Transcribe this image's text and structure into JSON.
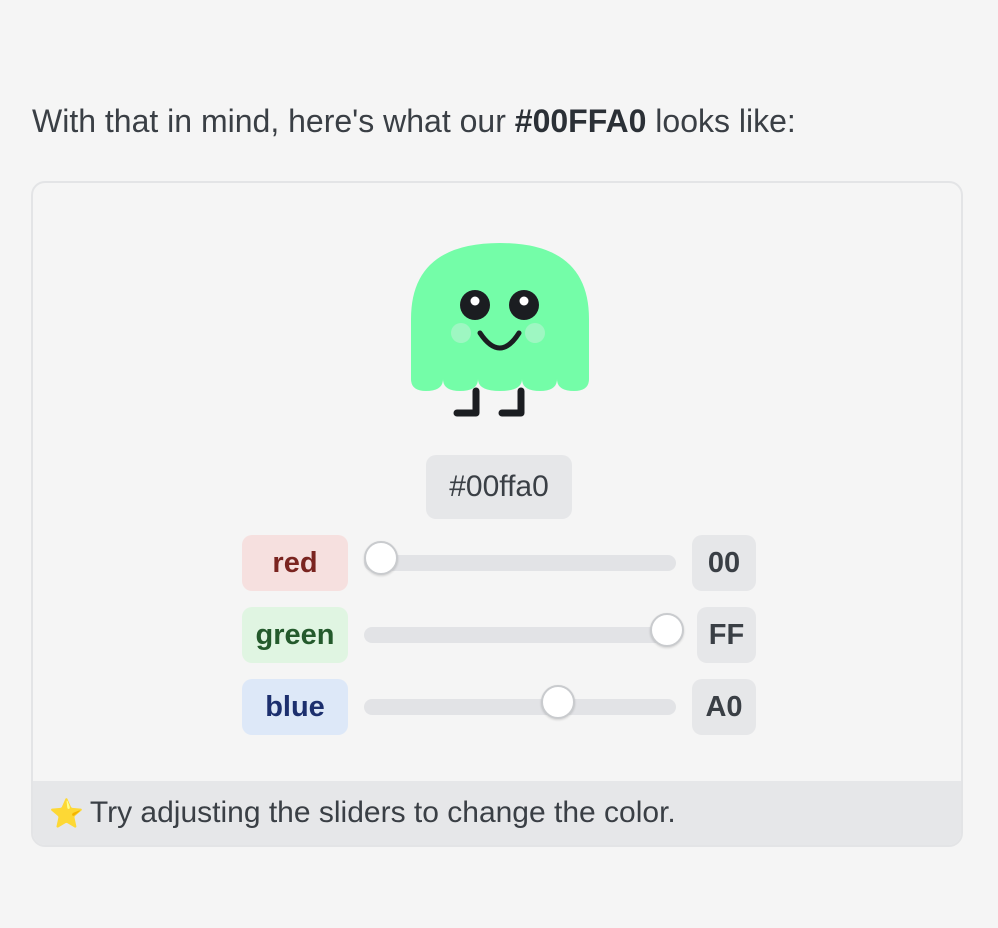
{
  "intro": {
    "prefix": "With that in mind, here's what our ",
    "code": "#00FFA0",
    "suffix": " looks like:"
  },
  "card": {
    "monster_color": "#74fda8",
    "hex_value": "#00ffa0",
    "sliders": [
      {
        "label": "red",
        "value_hex": "00",
        "level": 0.0
      },
      {
        "label": "green",
        "value_hex": "FF",
        "level": 1.0
      },
      {
        "label": "blue",
        "value_hex": "A0",
        "level": 0.627
      }
    ],
    "footer": {
      "icon": "star-icon",
      "text": "Try adjusting the sliders to change the color."
    }
  }
}
